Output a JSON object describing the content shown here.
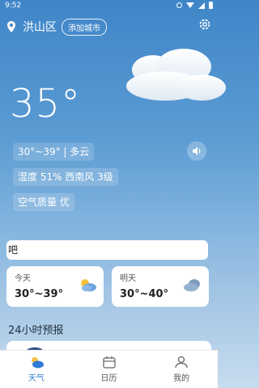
{
  "status_bar": {
    "time": "9:52"
  },
  "header": {
    "city": "洪山区",
    "add_city_label": "添加城市"
  },
  "current": {
    "temperature": "35°",
    "range_condition": "30°~39° | 多云",
    "humidity_wind": "湿度 51%    西南风 3级",
    "air_quality": "空气质量 优"
  },
  "notice": "吧",
  "forecast": [
    {
      "label": "今天",
      "range": "30°~39°",
      "icon": "partly-cloudy-icon"
    },
    {
      "label": "明天",
      "range": "30°~40°",
      "icon": "cloud-icon"
    }
  ],
  "hourly_title": "24小时预报",
  "nav": {
    "items": [
      {
        "label": "天气",
        "icon": "weather-icon",
        "active": true
      },
      {
        "label": "日历",
        "icon": "calendar-icon",
        "active": false
      },
      {
        "label": "我的",
        "icon": "profile-icon",
        "active": false
      }
    ]
  },
  "colors": {
    "accent": "#2f7ad6",
    "sky_top": "#3f86c8",
    "sky_bottom": "#c7dcee"
  }
}
